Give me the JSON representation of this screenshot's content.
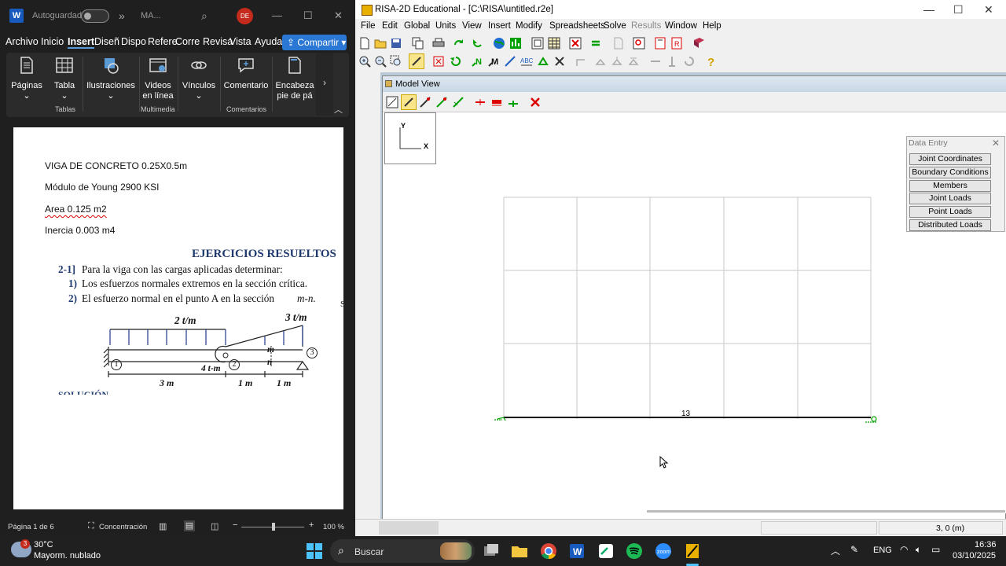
{
  "word": {
    "title": {
      "autosave": "Autoguardado",
      "doc_name": "MA...",
      "avatar": "DE",
      "more": "»"
    },
    "menu": [
      "Archivo",
      "Inicio",
      "Insert",
      "Diseñ",
      "Dispo",
      "Refere",
      "Corre",
      "Revisa",
      "Vista",
      "Ayuda"
    ],
    "active_tab": "Insert",
    "share_label": "Compartir",
    "ribbon": {
      "paginas": "Páginas",
      "tabla": "Tabla",
      "ilustraciones": "Ilustraciones",
      "videos": "Videos en línea",
      "vinculos": "Vínculos",
      "comentario": "Comentario",
      "encabezado_line1": "Encabeza",
      "encabezado_line2": "pie de pá",
      "group_tablas": "Tablas",
      "group_multimedia": "Multimedia",
      "group_comentarios": "Comentarios"
    },
    "document": {
      "lines": [
        "VIGA DE CONCRETO 0.25X0.5m",
        "Módulo de Young 2900 KSI",
        "Area 0.125 m2",
        "Inercia 0.003 m4"
      ],
      "heading": "EJERCICIOS RESUELTOS",
      "problem_num": "2-1]",
      "problem_text": "Para la viga con las cargas aplicadas determinar:",
      "item1_num": "1)",
      "item1": "Los esfuerzos normales extremos en la sección crítica.",
      "item2_num": "2)",
      "item2_a": "El esfuerzo normal en el punto A en la sección",
      "item2_b": "m-n.",
      "diagram": {
        "load1": "2 t/m",
        "load2": "3 t/m",
        "moment": "4 t-m",
        "m": "m",
        "n": "n",
        "node1": "1",
        "node2": "2",
        "node3": "3",
        "dim1": "3 m",
        "dim2": "1 m",
        "dim3": "1 m"
      },
      "cut_text": "SOLUCIÓN",
      "margin_mark": "S"
    },
    "status": {
      "page": "Página 1 de 6",
      "focus": "Concentración",
      "zoom": "100 %"
    }
  },
  "risa": {
    "title": "RISA-2D Educational - [C:\\RISA\\untitled.r2e]",
    "menu": [
      {
        "label": "File",
        "enabled": true
      },
      {
        "label": "Edit",
        "enabled": true
      },
      {
        "label": "Global",
        "enabled": true
      },
      {
        "label": "Units",
        "enabled": true
      },
      {
        "label": "View",
        "enabled": true
      },
      {
        "label": "Insert",
        "enabled": true
      },
      {
        "label": "Modify",
        "enabled": true
      },
      {
        "label": "Spreadsheets",
        "enabled": true
      },
      {
        "label": "Solve",
        "enabled": true
      },
      {
        "label": "Results",
        "enabled": false
      },
      {
        "label": "Window",
        "enabled": true
      },
      {
        "label": "Help",
        "enabled": true
      }
    ],
    "model_view": {
      "title": "Model View",
      "axis_y": "Y",
      "axis_x": "X",
      "member_label": "13"
    },
    "data_entry": {
      "title": "Data Entry",
      "buttons": [
        "Joint Coordinates",
        "Boundary Conditions",
        "Members",
        "Joint Loads",
        "Point Loads",
        "Distributed Loads"
      ]
    },
    "status": {
      "coords": "3, 0 (m)"
    }
  },
  "taskbar": {
    "weather_temp": "30°C",
    "weather_desc": "Mayorm. nublado",
    "weather_badge": "3",
    "search": "Buscar",
    "lang": "ENG",
    "time": "16:36",
    "date": "03/10/2025"
  },
  "colors": {
    "word_blue": "#185abd",
    "share": "#2b77d4",
    "risa_green": "#00a000",
    "grid": "#c8c8c8"
  }
}
